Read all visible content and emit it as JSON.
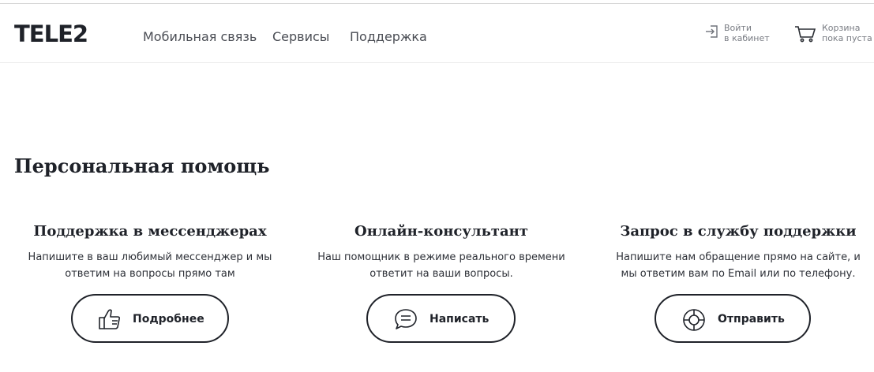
{
  "header": {
    "logo": "TELE2",
    "nav": [
      {
        "label": "Мобильная связь"
      },
      {
        "label": "Сервисы"
      },
      {
        "label": "Поддержка"
      }
    ],
    "login": {
      "line1": "Войти",
      "line2": "в кабинет",
      "icon": "login-icon"
    },
    "cart": {
      "line1": "Корзина",
      "line2": "пока пуста",
      "icon": "cart-icon"
    }
  },
  "main": {
    "title": "Персональная помощь",
    "cards": [
      {
        "title": "Поддержка в мессенджерах",
        "desc_line1": "Напишите в ваш любимый мессенджер и мы",
        "desc_line2": "ответим на вопросы прямо там",
        "button": "Подробнее",
        "icon": "thumbs-up-icon"
      },
      {
        "title": "Онлайн-консультант",
        "desc_line1": "Наш помощник в режиме реального времени",
        "desc_line2": "ответит на ваши вопросы.",
        "button": "Написать",
        "icon": "chat-bubble-icon"
      },
      {
        "title": "Запрос в службу поддержки",
        "desc_line1": "Напишите нам обращение прямо на сайте, и",
        "desc_line2": "мы ответим вам по Email или по телефону.",
        "button": "Отправить",
        "icon": "lifebuoy-icon"
      }
    ]
  },
  "colors": {
    "text": "#1f2229",
    "nav_text": "#4a4d54",
    "muted": "#7a7d84",
    "border": "#1f2229",
    "background": "#ffffff"
  }
}
